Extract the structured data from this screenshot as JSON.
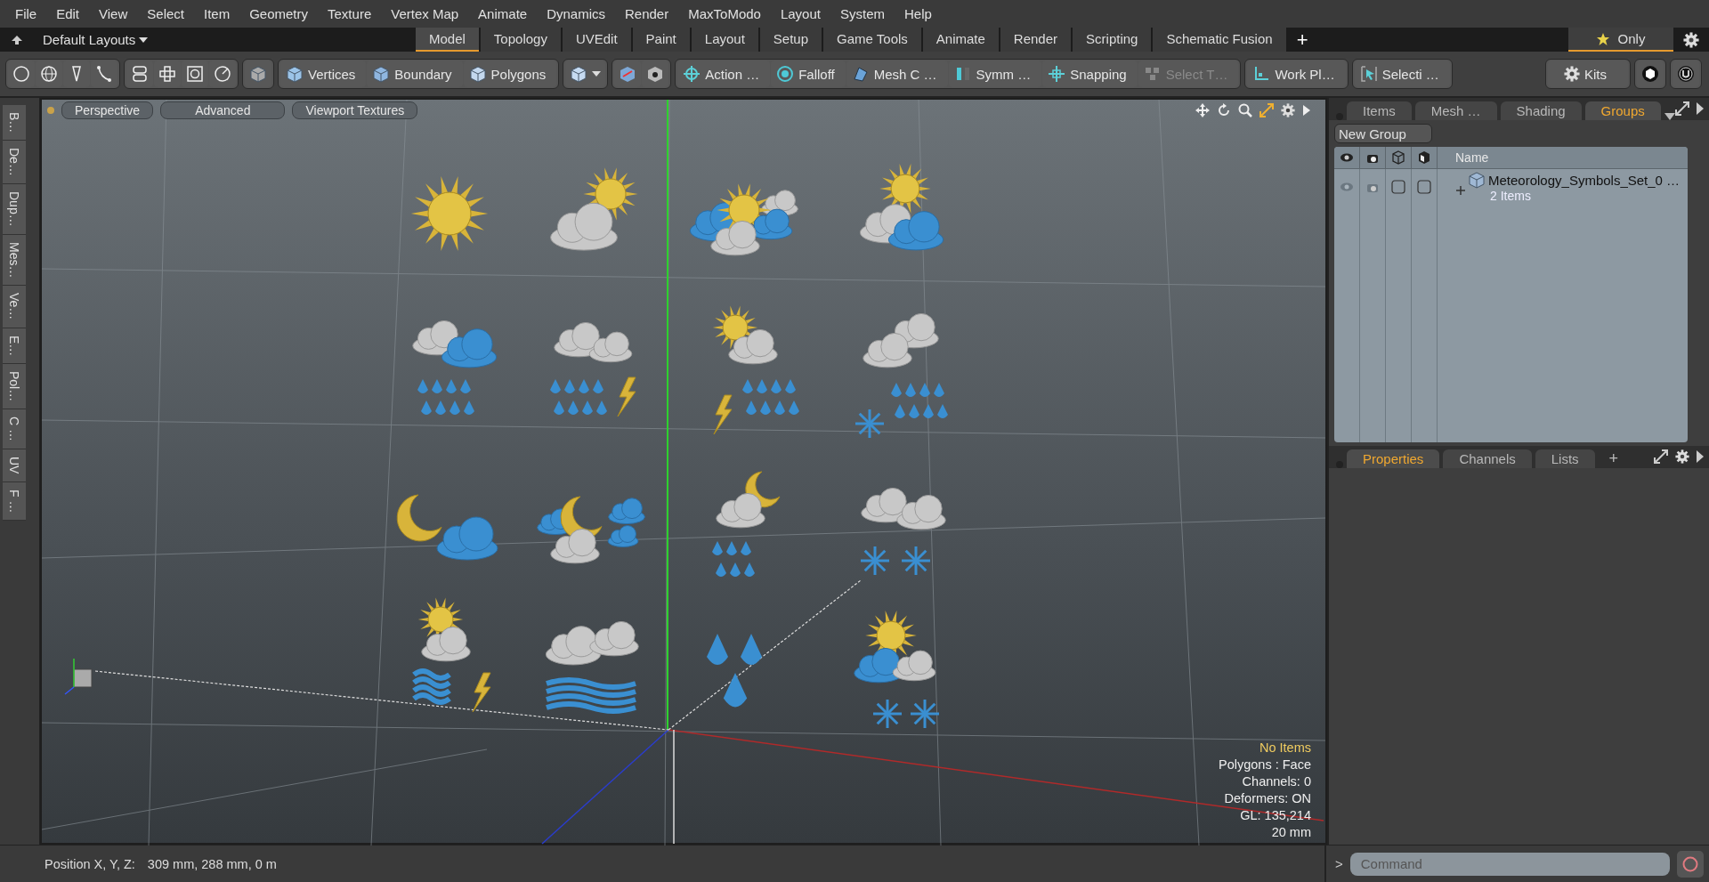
{
  "menu_bar": [
    "File",
    "Edit",
    "View",
    "Select",
    "Item",
    "Geometry",
    "Texture",
    "Vertex Map",
    "Animate",
    "Dynamics",
    "Render",
    "MaxToModo",
    "Layout",
    "System",
    "Help"
  ],
  "layout_bar": {
    "layouts_dropdown": "Default Layouts",
    "tabs": [
      {
        "label": "Model",
        "selected": true
      },
      {
        "label": "Topology",
        "selected": false
      },
      {
        "label": "UVEdit",
        "selected": false
      },
      {
        "label": "Paint",
        "selected": false
      },
      {
        "label": "Layout",
        "selected": false
      },
      {
        "label": "Setup",
        "selected": false
      },
      {
        "label": "Game Tools",
        "selected": false
      },
      {
        "label": "Animate",
        "selected": false
      },
      {
        "label": "Render",
        "selected": false
      },
      {
        "label": "Scripting",
        "selected": false
      },
      {
        "label": "Schematic Fusion",
        "selected": false
      }
    ],
    "add_tab": "+",
    "only_button": "Only"
  },
  "toolbar": [
    {
      "label": "Vertices",
      "disabled": false
    },
    {
      "label": "Boundary",
      "disabled": false
    },
    {
      "label": "Polygons",
      "disabled": false
    },
    {
      "label": "Action …",
      "disabled": false
    },
    {
      "label": "Falloff",
      "disabled": false
    },
    {
      "label": "Mesh C …",
      "disabled": false
    },
    {
      "label": "Symm …",
      "disabled": false
    },
    {
      "label": "Snapping",
      "disabled": false
    },
    {
      "label": "Select T…",
      "disabled": true
    },
    {
      "label": "Work Pl…",
      "disabled": false
    },
    {
      "label": "Selecti …",
      "disabled": false
    },
    {
      "label": "Kits",
      "disabled": false
    }
  ],
  "tool_strip": [
    "B…",
    "De…",
    "Dup…",
    "Mes…",
    "Ve…",
    "E…",
    "Pol…",
    "C …",
    "UV",
    "F …"
  ],
  "viewport": {
    "buttons": [
      "Perspective",
      "Advanced",
      "Viewport Textures"
    ],
    "info": [
      {
        "text": "No Items",
        "kind": "highlight"
      },
      {
        "text": "Polygons : Face",
        "kind": "plain"
      },
      {
        "text": "Channels: 0",
        "kind": "plain"
      },
      {
        "text": "Deformers: ON",
        "kind": "plain"
      },
      {
        "text": "GL: 135,214",
        "kind": "plain"
      },
      {
        "text": "20 mm",
        "kind": "plain"
      }
    ]
  },
  "groups_panel": {
    "tabs": [
      {
        "label": "Items",
        "selected": false
      },
      {
        "label": "Mesh …",
        "selected": false
      },
      {
        "label": "Shading",
        "selected": false
      },
      {
        "label": "Groups",
        "selected": true
      }
    ],
    "new_group_button": "New Group",
    "column_name": "Name",
    "rows": [
      {
        "name": "Meteorology_Symbols_Set_0 …",
        "count": "2 Items",
        "expanded": false
      }
    ]
  },
  "properties_panel": {
    "tabs": [
      {
        "label": "Properties",
        "selected": true
      },
      {
        "label": "Channels",
        "selected": false
      },
      {
        "label": "Lists",
        "selected": false
      }
    ],
    "add_tab": "+"
  },
  "status_bar": {
    "label": "Position X, Y, Z:",
    "value": "309 mm, 288 mm, 0 m"
  },
  "command": {
    "prompt": ">",
    "placeholder": "Command"
  }
}
